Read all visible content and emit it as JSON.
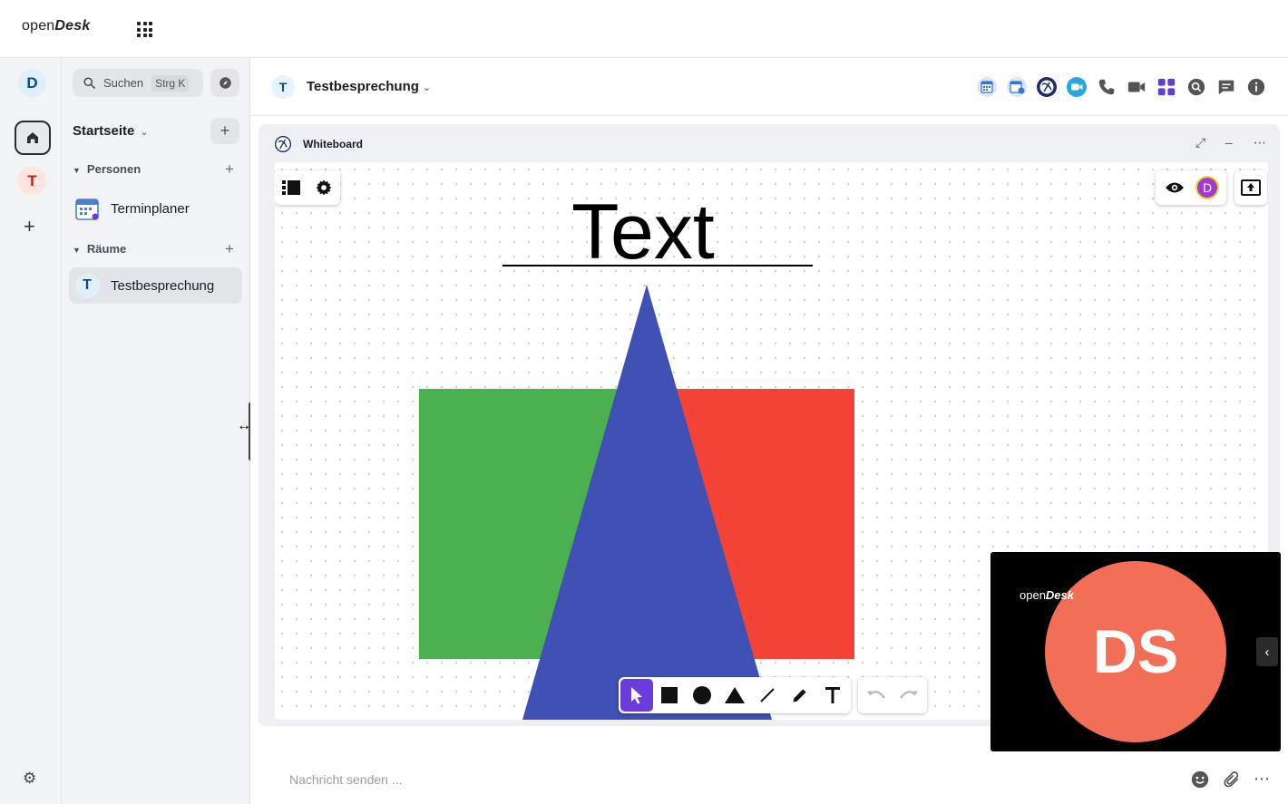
{
  "app": {
    "logo_regular": "open",
    "logo_bold": "Desk"
  },
  "rail": {
    "user_initial": "D",
    "space_initial": "T"
  },
  "sidebar": {
    "search_label": "Suchen",
    "search_shortcut": "Strg K",
    "home_title": "Startseite",
    "sections": {
      "people": "Personen",
      "rooms": "Räume"
    },
    "people_items": [
      {
        "label": "Terminplaner"
      }
    ],
    "rooms_items": [
      {
        "initial": "T",
        "label": "Testbesprechung"
      }
    ]
  },
  "room": {
    "initial": "T",
    "title": "Testbesprechung",
    "header_icons": [
      "calendar-icon",
      "calendar-settings-icon",
      "whiteboard-icon",
      "video-conference-icon",
      "phone-icon",
      "camera-icon",
      "widgets-icon",
      "search-icon",
      "threads-icon",
      "info-icon"
    ]
  },
  "widget": {
    "title": "Whiteboard",
    "whiteboard": {
      "text_element": "Text",
      "shapes": [
        {
          "type": "rectangle",
          "color": "#4caf50"
        },
        {
          "type": "rectangle",
          "color": "#f44336"
        },
        {
          "type": "triangle",
          "color": "#3f51b5"
        }
      ],
      "collaborator_initial": "D",
      "tools": [
        "select",
        "rectangle",
        "ellipse",
        "triangle",
        "line",
        "pen",
        "text"
      ]
    }
  },
  "pip": {
    "initials": "DS",
    "logo_regular": "open",
    "logo_bold": "Desk"
  },
  "composer": {
    "placeholder": "Nachricht senden ..."
  },
  "colors": {
    "accent": "#6c3bdb",
    "avatar_bg": "#f36e56"
  }
}
